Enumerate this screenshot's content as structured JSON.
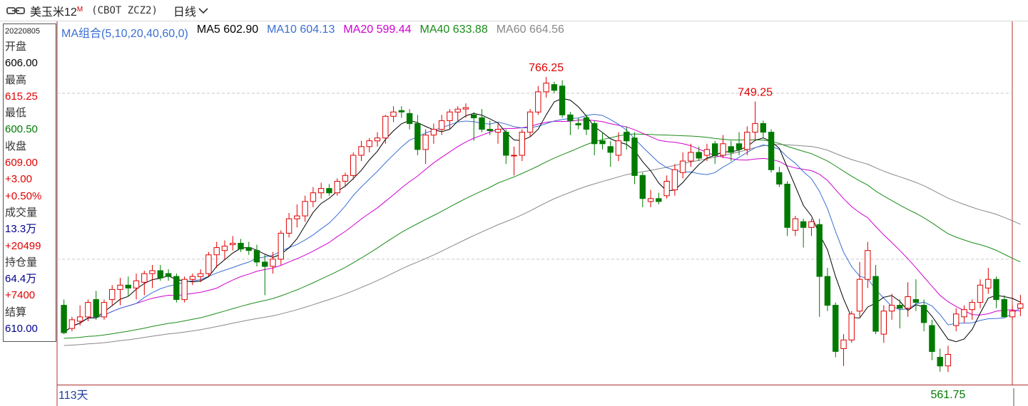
{
  "header": {
    "symbol_name": "美玉米12",
    "superscript": "M",
    "symbol_code": "(CBOT ZCZ2)",
    "period": "日线",
    "link_icon": "link-icon",
    "dropdown_icon": "chevron-down-icon"
  },
  "info": {
    "date": "20220805",
    "open_label": "开盘",
    "open": "606.00",
    "high_label": "最高",
    "high": "615.25",
    "low_label": "最低",
    "low": "600.50",
    "close_label": "收盘",
    "close": "609.00",
    "change": "+3.00",
    "change_pct": "+0.50%",
    "volume_label": "成交量",
    "volume": "13.3万",
    "volume_change": "+20499",
    "oi_label": "持仓量",
    "oi": "64.4万",
    "oi_change": "+7400",
    "settle_label": "结算",
    "settle": "610.00"
  },
  "legend": {
    "group": "MA组合(5,10,20,40,60,0)",
    "ma5": "MA5 602.90",
    "ma10": "MA10 604.13",
    "ma20": "MA20 599.44",
    "ma40": "MA40 633.88",
    "ma60": "MA60 664.56"
  },
  "footer": {
    "days": "113天"
  },
  "colors": {
    "up": "#e00000",
    "down": "#007a00",
    "ma5": "#000000",
    "ma10": "#3b6fd4",
    "ma20": "#d000d0",
    "ma40": "#1a8c1a",
    "ma60": "#888888"
  },
  "chart_data": {
    "type": "candlestick",
    "title": "",
    "xlabel": "",
    "ylabel": "",
    "ylim": [
      555,
      790
    ],
    "high_annotation": "766.25",
    "high_annotation2": "749.25",
    "low_annotation": "561.75",
    "candles": [
      {
        "o": 608,
        "h": 612,
        "l": 588,
        "c": 589
      },
      {
        "o": 592,
        "h": 600,
        "l": 590,
        "c": 598
      },
      {
        "o": 597,
        "h": 608,
        "l": 594,
        "c": 600
      },
      {
        "o": 600,
        "h": 612,
        "l": 597,
        "c": 610
      },
      {
        "o": 612,
        "h": 618,
        "l": 598,
        "c": 600
      },
      {
        "o": 600,
        "h": 612,
        "l": 598,
        "c": 610
      },
      {
        "o": 612,
        "h": 622,
        "l": 608,
        "c": 619
      },
      {
        "o": 619,
        "h": 627,
        "l": 608,
        "c": 622
      },
      {
        "o": 622,
        "h": 628,
        "l": 614,
        "c": 620
      },
      {
        "o": 620,
        "h": 630,
        "l": 612,
        "c": 625
      },
      {
        "o": 624,
        "h": 632,
        "l": 615,
        "c": 630
      },
      {
        "o": 630,
        "h": 636,
        "l": 620,
        "c": 632
      },
      {
        "o": 632,
        "h": 636,
        "l": 625,
        "c": 627
      },
      {
        "o": 630,
        "h": 633,
        "l": 625,
        "c": 628
      },
      {
        "o": 628,
        "h": 630,
        "l": 610,
        "c": 612
      },
      {
        "o": 612,
        "h": 628,
        "l": 610,
        "c": 626
      },
      {
        "o": 626,
        "h": 630,
        "l": 622,
        "c": 628
      },
      {
        "o": 628,
        "h": 633,
        "l": 624,
        "c": 630
      },
      {
        "o": 630,
        "h": 645,
        "l": 628,
        "c": 643
      },
      {
        "o": 643,
        "h": 652,
        "l": 634,
        "c": 648
      },
      {
        "o": 646,
        "h": 653,
        "l": 640,
        "c": 649
      },
      {
        "o": 650,
        "h": 656,
        "l": 646,
        "c": 651
      },
      {
        "o": 651,
        "h": 654,
        "l": 645,
        "c": 647
      },
      {
        "o": 648,
        "h": 652,
        "l": 643,
        "c": 646
      },
      {
        "o": 646,
        "h": 650,
        "l": 635,
        "c": 638
      },
      {
        "o": 638,
        "h": 643,
        "l": 615,
        "c": 635
      },
      {
        "o": 635,
        "h": 645,
        "l": 630,
        "c": 640
      },
      {
        "o": 640,
        "h": 660,
        "l": 636,
        "c": 658
      },
      {
        "o": 658,
        "h": 672,
        "l": 655,
        "c": 668
      },
      {
        "o": 668,
        "h": 678,
        "l": 662,
        "c": 670
      },
      {
        "o": 670,
        "h": 684,
        "l": 666,
        "c": 680
      },
      {
        "o": 680,
        "h": 690,
        "l": 676,
        "c": 686
      },
      {
        "o": 686,
        "h": 693,
        "l": 682,
        "c": 689
      },
      {
        "o": 689,
        "h": 692,
        "l": 684,
        "c": 686
      },
      {
        "o": 686,
        "h": 696,
        "l": 684,
        "c": 694
      },
      {
        "o": 694,
        "h": 700,
        "l": 690,
        "c": 698
      },
      {
        "o": 698,
        "h": 714,
        "l": 695,
        "c": 712
      },
      {
        "o": 712,
        "h": 722,
        "l": 708,
        "c": 718
      },
      {
        "o": 718,
        "h": 724,
        "l": 714,
        "c": 722
      },
      {
        "o": 722,
        "h": 728,
        "l": 718,
        "c": 724
      },
      {
        "o": 724,
        "h": 740,
        "l": 720,
        "c": 739
      },
      {
        "o": 739,
        "h": 746,
        "l": 735,
        "c": 742
      },
      {
        "o": 743,
        "h": 746,
        "l": 738,
        "c": 742
      },
      {
        "o": 741,
        "h": 744,
        "l": 730,
        "c": 734
      },
      {
        "o": 734,
        "h": 740,
        "l": 712,
        "c": 716
      },
      {
        "o": 716,
        "h": 730,
        "l": 706,
        "c": 726
      },
      {
        "o": 726,
        "h": 734,
        "l": 720,
        "c": 730
      },
      {
        "o": 730,
        "h": 740,
        "l": 726,
        "c": 736
      },
      {
        "o": 736,
        "h": 744,
        "l": 730,
        "c": 742
      },
      {
        "o": 742,
        "h": 746,
        "l": 736,
        "c": 744
      },
      {
        "o": 744,
        "h": 748,
        "l": 738,
        "c": 745
      },
      {
        "o": 740,
        "h": 742,
        "l": 722,
        "c": 738
      },
      {
        "o": 738,
        "h": 744,
        "l": 728,
        "c": 730
      },
      {
        "o": 730,
        "h": 736,
        "l": 726,
        "c": 729
      },
      {
        "o": 728,
        "h": 734,
        "l": 720,
        "c": 730
      },
      {
        "o": 728,
        "h": 730,
        "l": 706,
        "c": 712
      },
      {
        "o": 712,
        "h": 718,
        "l": 698,
        "c": 712
      },
      {
        "o": 712,
        "h": 730,
        "l": 708,
        "c": 728
      },
      {
        "o": 728,
        "h": 744,
        "l": 725,
        "c": 742
      },
      {
        "o": 742,
        "h": 760,
        "l": 740,
        "c": 756
      },
      {
        "o": 756,
        "h": 766.25,
        "l": 752,
        "c": 762
      },
      {
        "o": 761,
        "h": 763,
        "l": 755,
        "c": 757
      },
      {
        "o": 760,
        "h": 764,
        "l": 738,
        "c": 740
      },
      {
        "o": 740,
        "h": 742,
        "l": 726,
        "c": 736
      },
      {
        "o": 734,
        "h": 738,
        "l": 730,
        "c": 733
      },
      {
        "o": 738,
        "h": 740,
        "l": 726,
        "c": 730
      },
      {
        "o": 734,
        "h": 736,
        "l": 712,
        "c": 720
      },
      {
        "o": 722,
        "h": 728,
        "l": 716,
        "c": 720
      },
      {
        "o": 718,
        "h": 722,
        "l": 704,
        "c": 714
      },
      {
        "o": 712,
        "h": 728,
        "l": 708,
        "c": 722
      },
      {
        "o": 728,
        "h": 732,
        "l": 716,
        "c": 722
      },
      {
        "o": 724,
        "h": 728,
        "l": 692,
        "c": 698
      },
      {
        "o": 698,
        "h": 700,
        "l": 676,
        "c": 682
      },
      {
        "o": 680,
        "h": 688,
        "l": 676,
        "c": 682
      },
      {
        "o": 682,
        "h": 686,
        "l": 678,
        "c": 680
      },
      {
        "o": 684,
        "h": 698,
        "l": 682,
        "c": 694
      },
      {
        "o": 688,
        "h": 706,
        "l": 684,
        "c": 702
      },
      {
        "o": 700,
        "h": 714,
        "l": 696,
        "c": 708
      },
      {
        "o": 708,
        "h": 720,
        "l": 704,
        "c": 714
      },
      {
        "o": 714,
        "h": 718,
        "l": 708,
        "c": 710
      },
      {
        "o": 712,
        "h": 720,
        "l": 708,
        "c": 716
      },
      {
        "o": 720,
        "h": 722,
        "l": 706,
        "c": 712
      },
      {
        "o": 712,
        "h": 726,
        "l": 710,
        "c": 720
      },
      {
        "o": 718,
        "h": 722,
        "l": 708,
        "c": 714
      },
      {
        "o": 720,
        "h": 728,
        "l": 712,
        "c": 716
      },
      {
        "o": 716,
        "h": 732,
        "l": 712,
        "c": 728
      },
      {
        "o": 728,
        "h": 749.25,
        "l": 722,
        "c": 734
      },
      {
        "o": 734,
        "h": 736,
        "l": 724,
        "c": 728
      },
      {
        "o": 728,
        "h": 730,
        "l": 700,
        "c": 702
      },
      {
        "o": 700,
        "h": 704,
        "l": 690,
        "c": 692
      },
      {
        "o": 692,
        "h": 694,
        "l": 656,
        "c": 662
      },
      {
        "o": 660,
        "h": 670,
        "l": 656,
        "c": 668
      },
      {
        "o": 666,
        "h": 668,
        "l": 648,
        "c": 662
      },
      {
        "o": 662,
        "h": 668,
        "l": 656,
        "c": 666
      },
      {
        "o": 664,
        "h": 668,
        "l": 600,
        "c": 628
      },
      {
        "o": 628,
        "h": 634,
        "l": 604,
        "c": 608
      },
      {
        "o": 608,
        "h": 610,
        "l": 572,
        "c": 576
      },
      {
        "o": 578,
        "h": 588,
        "l": 566,
        "c": 584
      },
      {
        "o": 584,
        "h": 604,
        "l": 582,
        "c": 602
      },
      {
        "o": 604,
        "h": 638,
        "l": 600,
        "c": 626
      },
      {
        "o": 626,
        "h": 652,
        "l": 620,
        "c": 646
      },
      {
        "o": 628,
        "h": 636,
        "l": 588,
        "c": 590
      },
      {
        "o": 588,
        "h": 608,
        "l": 582,
        "c": 604
      },
      {
        "o": 604,
        "h": 616,
        "l": 598,
        "c": 608
      },
      {
        "o": 608,
        "h": 612,
        "l": 592,
        "c": 606
      },
      {
        "o": 606,
        "h": 624,
        "l": 600,
        "c": 614
      },
      {
        "o": 612,
        "h": 626,
        "l": 604,
        "c": 610
      },
      {
        "o": 608,
        "h": 612,
        "l": 590,
        "c": 596
      },
      {
        "o": 594,
        "h": 598,
        "l": 570,
        "c": 576
      },
      {
        "o": 572,
        "h": 578,
        "l": 562,
        "c": 566
      },
      {
        "o": 566,
        "h": 580,
        "l": 561.75,
        "c": 574
      },
      {
        "o": 594,
        "h": 606,
        "l": 590,
        "c": 602
      },
      {
        "o": 600,
        "h": 608,
        "l": 596,
        "c": 605
      },
      {
        "o": 605,
        "h": 612,
        "l": 598,
        "c": 610
      },
      {
        "o": 610,
        "h": 626,
        "l": 606,
        "c": 622
      },
      {
        "o": 620,
        "h": 634,
        "l": 616,
        "c": 626
      },
      {
        "o": 626,
        "h": 628,
        "l": 606,
        "c": 612
      },
      {
        "o": 612,
        "h": 615,
        "l": 600,
        "c": 600
      },
      {
        "o": 600,
        "h": 608,
        "l": 598,
        "c": 604
      },
      {
        "o": 606,
        "h": 615.25,
        "l": 600.5,
        "c": 609
      }
    ]
  }
}
